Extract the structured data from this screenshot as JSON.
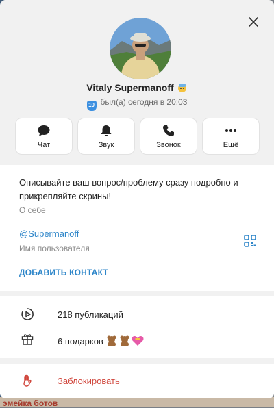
{
  "profile": {
    "name": "Vitaly Supermanoff",
    "level": "10",
    "status": "был(а) сегодня в 20:03"
  },
  "actions": [
    {
      "label": "Чат",
      "icon": "chat-icon"
    },
    {
      "label": "Звук",
      "icon": "bell-icon"
    },
    {
      "label": "Звонок",
      "icon": "phone-icon"
    },
    {
      "label": "Ещё",
      "icon": "more-icon"
    }
  ],
  "about": {
    "text": "Описывайте ваш вопрос/проблему сразу подробно и прикрепляйте скрины!",
    "label": "О себе"
  },
  "username": {
    "value": "@Supermanoff",
    "label": "Имя пользователя"
  },
  "add_contact": "ДОБАВИТЬ КОНТАКТ",
  "stats": {
    "publications": "218 публикаций",
    "gifts": "6 подарков"
  },
  "block": "Заблокировать",
  "background": {
    "bottom_text": "эмейка ботов"
  },
  "colors": {
    "accent": "#2e86c9",
    "danger": "#d0453b",
    "badge": "#3b8fe0"
  }
}
